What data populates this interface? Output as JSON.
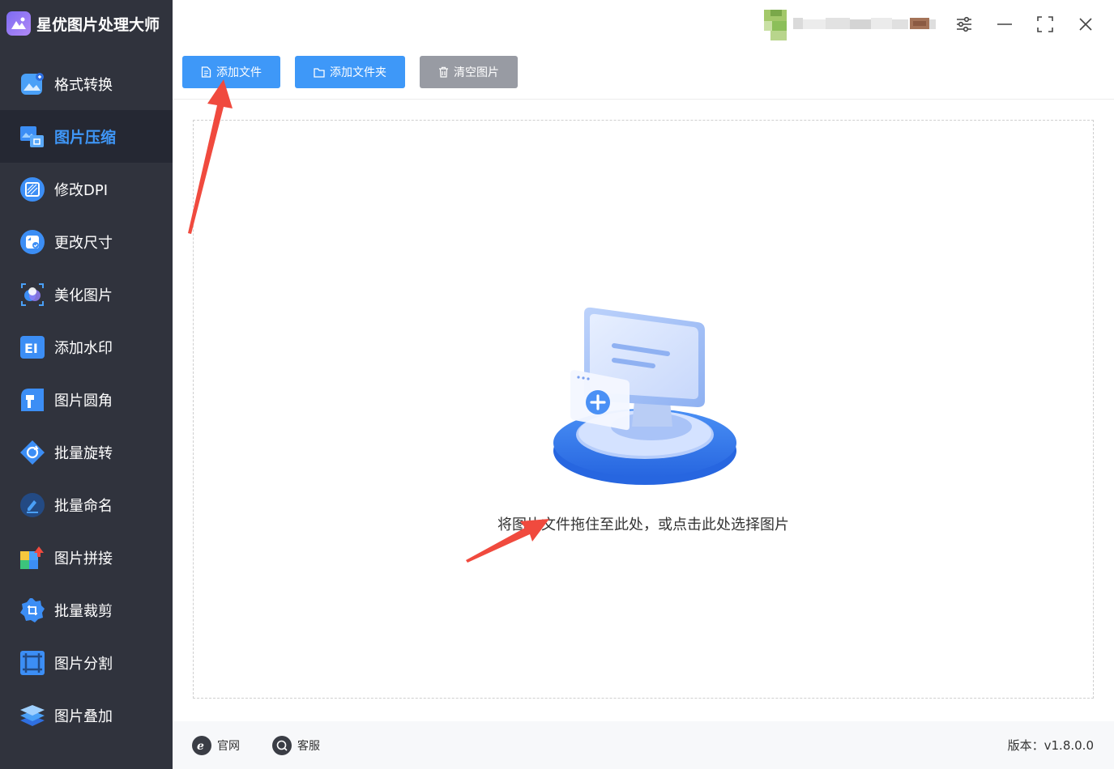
{
  "app": {
    "title": "星优图片处理大师"
  },
  "sidebar": {
    "items": [
      {
        "label": "格式转换",
        "icon": "image-convert-icon"
      },
      {
        "label": "图片压缩",
        "icon": "image-compress-icon",
        "active": true
      },
      {
        "label": "修改DPI",
        "icon": "dpi-icon"
      },
      {
        "label": "更改尺寸",
        "icon": "resize-icon"
      },
      {
        "label": "美化图片",
        "icon": "beautify-icon"
      },
      {
        "label": "添加水印",
        "icon": "watermark-icon"
      },
      {
        "label": "图片圆角",
        "icon": "round-corner-icon"
      },
      {
        "label": "批量旋转",
        "icon": "rotate-icon"
      },
      {
        "label": "批量命名",
        "icon": "rename-icon"
      },
      {
        "label": "图片拼接",
        "icon": "puzzle-icon"
      },
      {
        "label": "批量裁剪",
        "icon": "crop-icon"
      },
      {
        "label": "图片分割",
        "icon": "split-icon"
      },
      {
        "label": "图片叠加",
        "icon": "layers-icon"
      }
    ]
  },
  "toolbar": {
    "add_file": "添加文件",
    "add_folder": "添加文件夹",
    "clear": "清空图片"
  },
  "dropzone": {
    "hint": "将图片文件拖住至此处，或点击此处选择图片"
  },
  "footer": {
    "website": "官网",
    "support": "客服",
    "version": "版本：v1.8.0.0"
  },
  "colors": {
    "sidebar_bg": "#30333d",
    "active_bg": "#252833",
    "accent": "#3e98f8",
    "gray_button": "#989ba3",
    "annotation_arrow": "#f04a3e"
  }
}
